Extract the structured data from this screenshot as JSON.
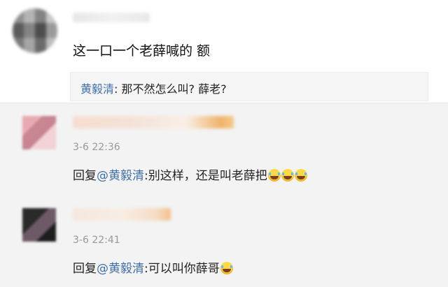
{
  "main_comment": {
    "text": "这一口一个老薛喊的  额",
    "quote": {
      "author": "黄毅清",
      "separator": ": ",
      "text": "那不然怎么叫? 薛老?"
    }
  },
  "replies": [
    {
      "time": "3-6 22:36",
      "prefix": "回复",
      "mention": "@黄毅清",
      "text": ":别这样，还是叫老薛把",
      "emoji_names": [
        "laugh-cry-icon",
        "laugh-cry-icon",
        "laugh-cry-icon"
      ]
    },
    {
      "time": "3-6 22:41",
      "prefix": "回复",
      "mention": "@黄毅清",
      "text": ":可以叫你薛哥",
      "emoji_names": [
        "laugh-cry-icon"
      ]
    }
  ],
  "colors": {
    "link_blue": "#3f6fa8",
    "time_gray": "#999999",
    "reply_background": "#f3f3f3"
  }
}
